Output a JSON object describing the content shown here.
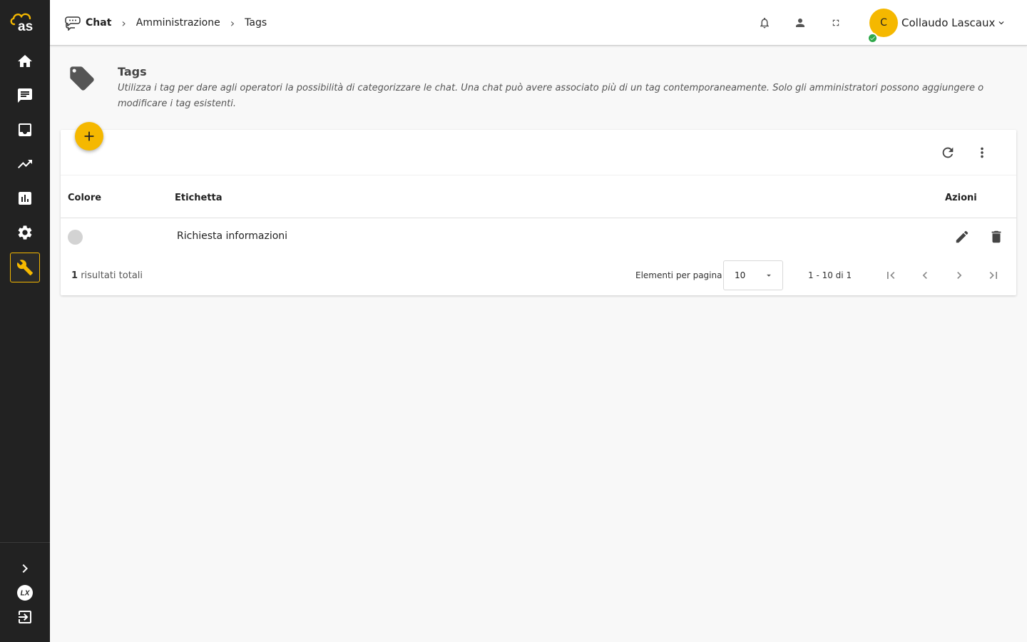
{
  "brand": {
    "logo_text": "as",
    "accent": "#f5b800",
    "sidebar_bg": "#222222"
  },
  "sidebar": {
    "items": [
      {
        "name": "home",
        "icon": "home-icon"
      },
      {
        "name": "chat",
        "icon": "chat-icon"
      },
      {
        "name": "inbox",
        "icon": "inbox-icon"
      },
      {
        "name": "trends",
        "icon": "trending-up-icon"
      },
      {
        "name": "reports",
        "icon": "bar-chart-icon"
      },
      {
        "name": "settings",
        "icon": "gear-icon"
      },
      {
        "name": "administration",
        "icon": "wrench-icon",
        "active": true
      }
    ],
    "bottom": [
      {
        "name": "expand",
        "icon": "chevron-right-icon"
      },
      {
        "name": "lascaux",
        "icon": "lx-logo-icon"
      },
      {
        "name": "logout",
        "icon": "logout-icon"
      }
    ]
  },
  "header": {
    "breadcrumb": [
      {
        "label": "Chat",
        "icon": "chat-bubbles-icon"
      },
      {
        "label": "Amministrazione"
      },
      {
        "label": "Tags"
      }
    ],
    "icons": [
      "bell-icon",
      "person-icon",
      "fullscreen-icon"
    ],
    "user": {
      "initial": "C",
      "name": "Collaudo Lascaux",
      "status": "online",
      "status_color": "#2ea84a"
    }
  },
  "page": {
    "icon": "tag-icon",
    "title": "Tags",
    "description": "Utilizza i tag per dare agli operatori la possibilità di categorizzare le chat. Una chat può avere associato più di un tag contemporaneamente. Solo gli amministratori possono aggiungere o modificare i tag esistenti."
  },
  "table": {
    "columns": [
      "Colore",
      "Etichetta",
      "Azioni"
    ],
    "rows": [
      {
        "color": "#d3d3d3",
        "label": "Richiesta informazioni",
        "actions": [
          "edit-icon",
          "delete-icon"
        ]
      }
    ],
    "footer": {
      "total_count": "1",
      "total_suffix": "risultati totali",
      "per_page_label": "Elementi per pagina",
      "per_page_value": "10",
      "range": "1 - 10 di 1"
    }
  }
}
